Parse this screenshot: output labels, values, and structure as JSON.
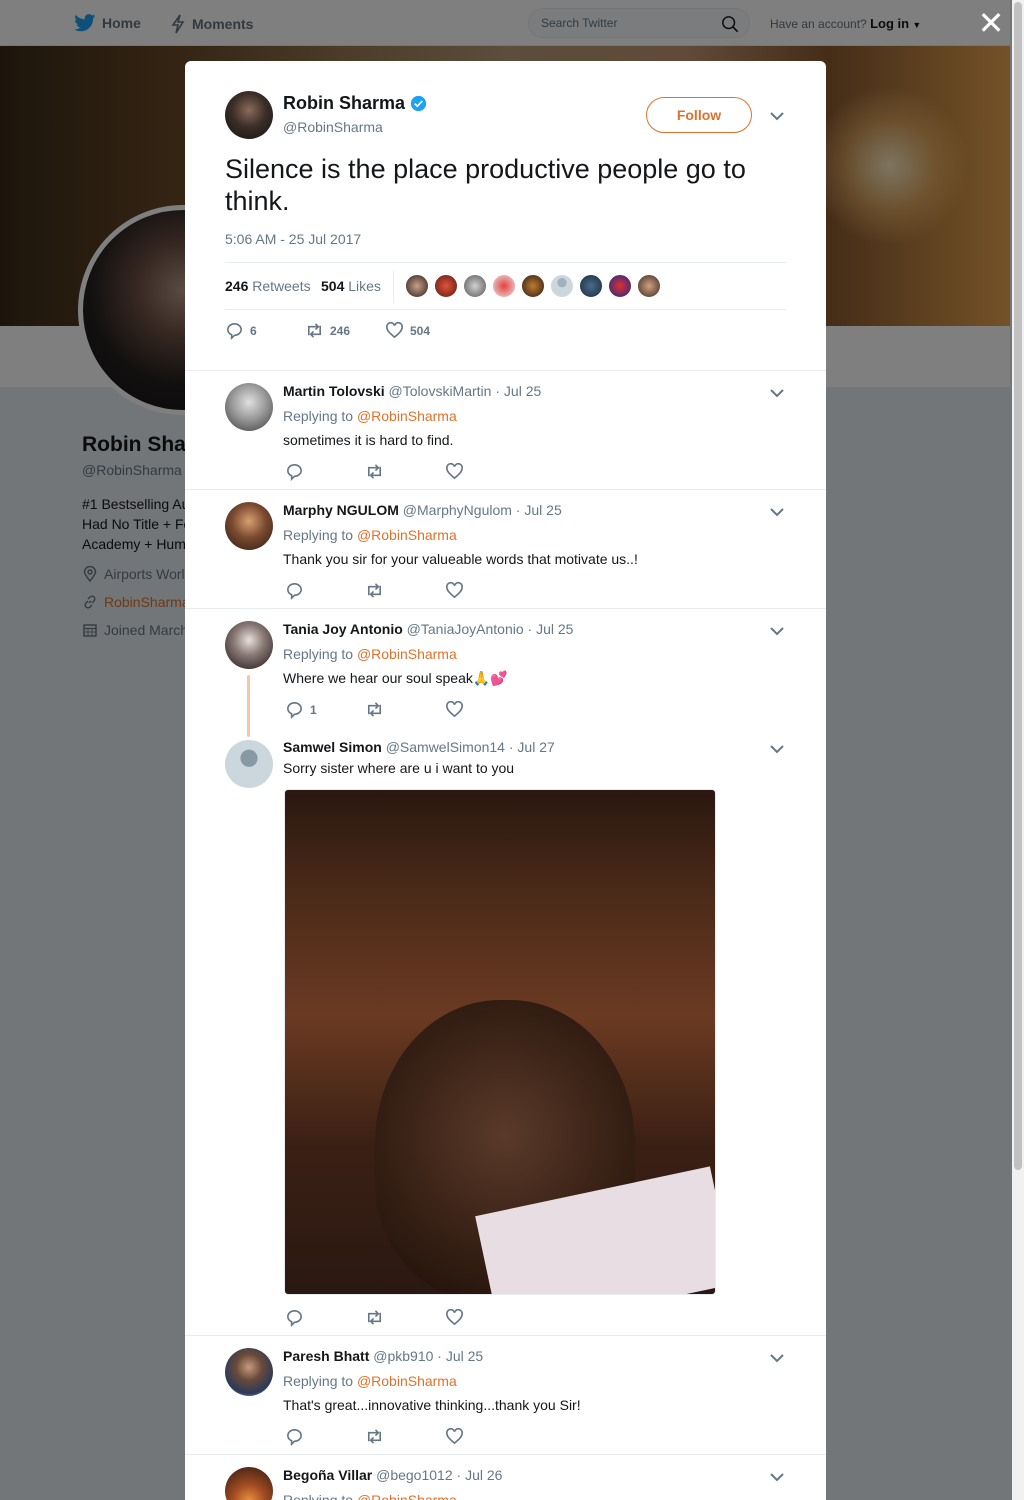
{
  "nav": {
    "home": "Home",
    "moments": "Moments",
    "search_placeholder": "Search Twitter",
    "have_account": "Have an account?",
    "login": "Log in"
  },
  "profile": {
    "name": "Robin Sha",
    "handle": "@RobinSharma",
    "bio": "#1 Bestselling Au\nHad No Title + Fc\nAcademy + Hum",
    "location": "Airports Worl",
    "website": "RobinSharma",
    "joined": "Joined March"
  },
  "tweet": {
    "author_name": "Robin Sharma",
    "author_handle": "@RobinSharma",
    "follow_label": "Follow",
    "text": "Silence is the place productive people go to think.",
    "timestamp": "5:06 AM - 25 Jul 2017",
    "retweets_count": "246",
    "retweets_label": "Retweets",
    "likes_count": "504",
    "likes_label": "Likes",
    "actions": {
      "replies": "6",
      "retweets": "246",
      "likes": "504"
    }
  },
  "replies": [
    {
      "name": "Martin Tolovski",
      "handle": "@TolovskiMartin",
      "date": "Jul 25",
      "replying_prefix": "Replying to",
      "replying_to": "@RobinSharma",
      "text": "sometimes it is hard to find.",
      "reply_count": ""
    },
    {
      "name": "Marphy NGULOM",
      "handle": "@MarphyNgulom",
      "date": "Jul 25",
      "replying_prefix": "Replying to",
      "replying_to": "@RobinSharma",
      "text": "Thank you sir for your valueable words that motivate us..!",
      "reply_count": ""
    },
    {
      "name": "Tania Joy Antonio",
      "handle": "@TaniaJoyAntonio",
      "date": "Jul 25",
      "replying_prefix": "Replying to",
      "replying_to": "@RobinSharma",
      "text": "Where we hear our soul speak🙏💕",
      "reply_count": "1"
    },
    {
      "name": "Samwel Simon",
      "handle": "@SamwelSimon14",
      "date": "Jul 27",
      "text": "Sorry sister where are u i want to you"
    },
    {
      "name": "Paresh Bhatt",
      "handle": "@pkb910",
      "date": "Jul 25",
      "replying_prefix": "Replying to",
      "replying_to": "@RobinSharma",
      "text": "That's great...innovative thinking...thank you Sir!",
      "reply_count": ""
    },
    {
      "name": "Begoña Villar",
      "handle": "@bego1012",
      "date": "Jul 26",
      "replying_prefix": "Replying to",
      "replying_to": "@RobinSharma"
    }
  ],
  "colors": {
    "accent": "#e0712b",
    "twitter_blue": "#1da1f2",
    "muted": "#657786",
    "overlay": "rgba(0,0,0,0.5)"
  },
  "icons": [
    "twitter-bird-icon",
    "moments-icon",
    "search-icon",
    "caret-down-icon",
    "close-icon",
    "verified-icon",
    "chevron-down-icon",
    "reply-icon",
    "retweet-icon",
    "heart-icon",
    "location-icon",
    "link-icon",
    "calendar-icon"
  ]
}
